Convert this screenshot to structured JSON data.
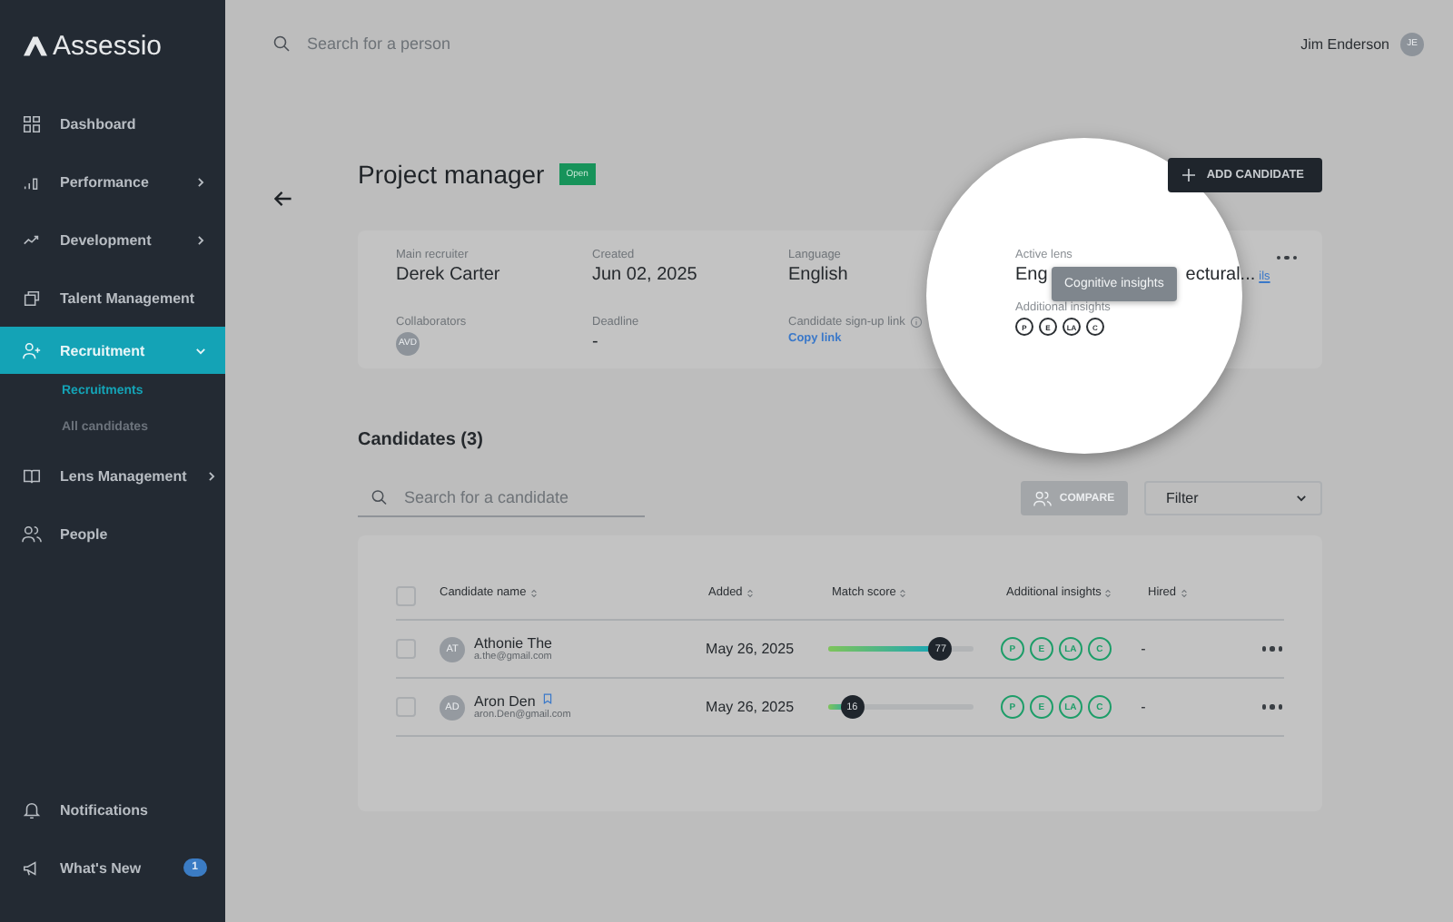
{
  "logo": "Assessio",
  "sidebar": {
    "items": [
      {
        "label": "Dashboard",
        "kind": "link",
        "selected": false
      },
      {
        "label": "Performance",
        "kind": "group",
        "selected": false,
        "expanded": false
      },
      {
        "label": "Development",
        "kind": "group",
        "selected": false,
        "expanded": false
      },
      {
        "label": "Talent Management",
        "kind": "link",
        "selected": false
      },
      {
        "label": "Recruitment",
        "kind": "group",
        "selected": true,
        "expanded": true,
        "children": [
          {
            "label": "Recruitments",
            "selected": true
          },
          {
            "label": "All candidates",
            "selected": false
          }
        ]
      },
      {
        "label": "Lens Management",
        "kind": "group",
        "selected": false,
        "expanded": false
      },
      {
        "label": "People",
        "kind": "link",
        "selected": false
      }
    ],
    "bottom_items": [
      {
        "label": "Notifications"
      },
      {
        "label": "What's New",
        "badge": "1"
      }
    ]
  },
  "topbar": {
    "search": {
      "placeholder": "Search for a person"
    },
    "user": {
      "name": "Jim Enderson",
      "initials": "JE"
    }
  },
  "page": {
    "title": "Project manager",
    "status": "Open",
    "add_button": "ADD CANDIDATE"
  },
  "details": {
    "fields": [
      {
        "kind": "text",
        "label": "Main recruiter",
        "value": "Derek Carter"
      },
      {
        "kind": "text",
        "label": "Created",
        "value": "Jun 02, 2025"
      },
      {
        "kind": "text",
        "label": "Language",
        "value": "English"
      },
      {
        "kind": "avatar",
        "label": "Collaborators",
        "value": "AVD"
      },
      {
        "kind": "text",
        "label": "Deadline",
        "value": "-"
      },
      {
        "kind": "link",
        "label": "Candidate sign-up link",
        "value": "Copy link"
      }
    ],
    "active_lens": {
      "label": "Active lens",
      "value_start": "Eng",
      "value_end": "ectural...",
      "link": "ils"
    },
    "tooltip": "Cognitive insights",
    "additional_insights": {
      "label": "Additional insights",
      "badges": [
        "P",
        "E",
        "LA",
        "C"
      ]
    }
  },
  "candidates": {
    "title": "Candidates (3)",
    "search": {
      "placeholder": "Search for a candidate"
    },
    "compare": {
      "label": "COMPARE",
      "disabled": true
    },
    "filter": "Filter",
    "select_all_checked": false,
    "columns": [
      "Candidate name",
      "Added",
      "Match score",
      "Additional insights",
      "Hired"
    ],
    "rows": [
      {
        "checked": false,
        "initials": "AT",
        "name": "Athonie The",
        "email": "a.the@gmail.com",
        "flagged": false,
        "added": "May 26, 2025",
        "score": "77",
        "level": 0.77,
        "insights": [
          "P",
          "E",
          "LA",
          "C"
        ],
        "hired": "-"
      },
      {
        "checked": false,
        "initials": "AD",
        "name": "Aron Den",
        "email": "aron.Den@gmail.com",
        "flagged": true,
        "added": "May 26, 2025",
        "score": "16",
        "level": 0.16,
        "insights": [
          "P",
          "E",
          "LA",
          "C"
        ],
        "hired": "-"
      }
    ]
  }
}
